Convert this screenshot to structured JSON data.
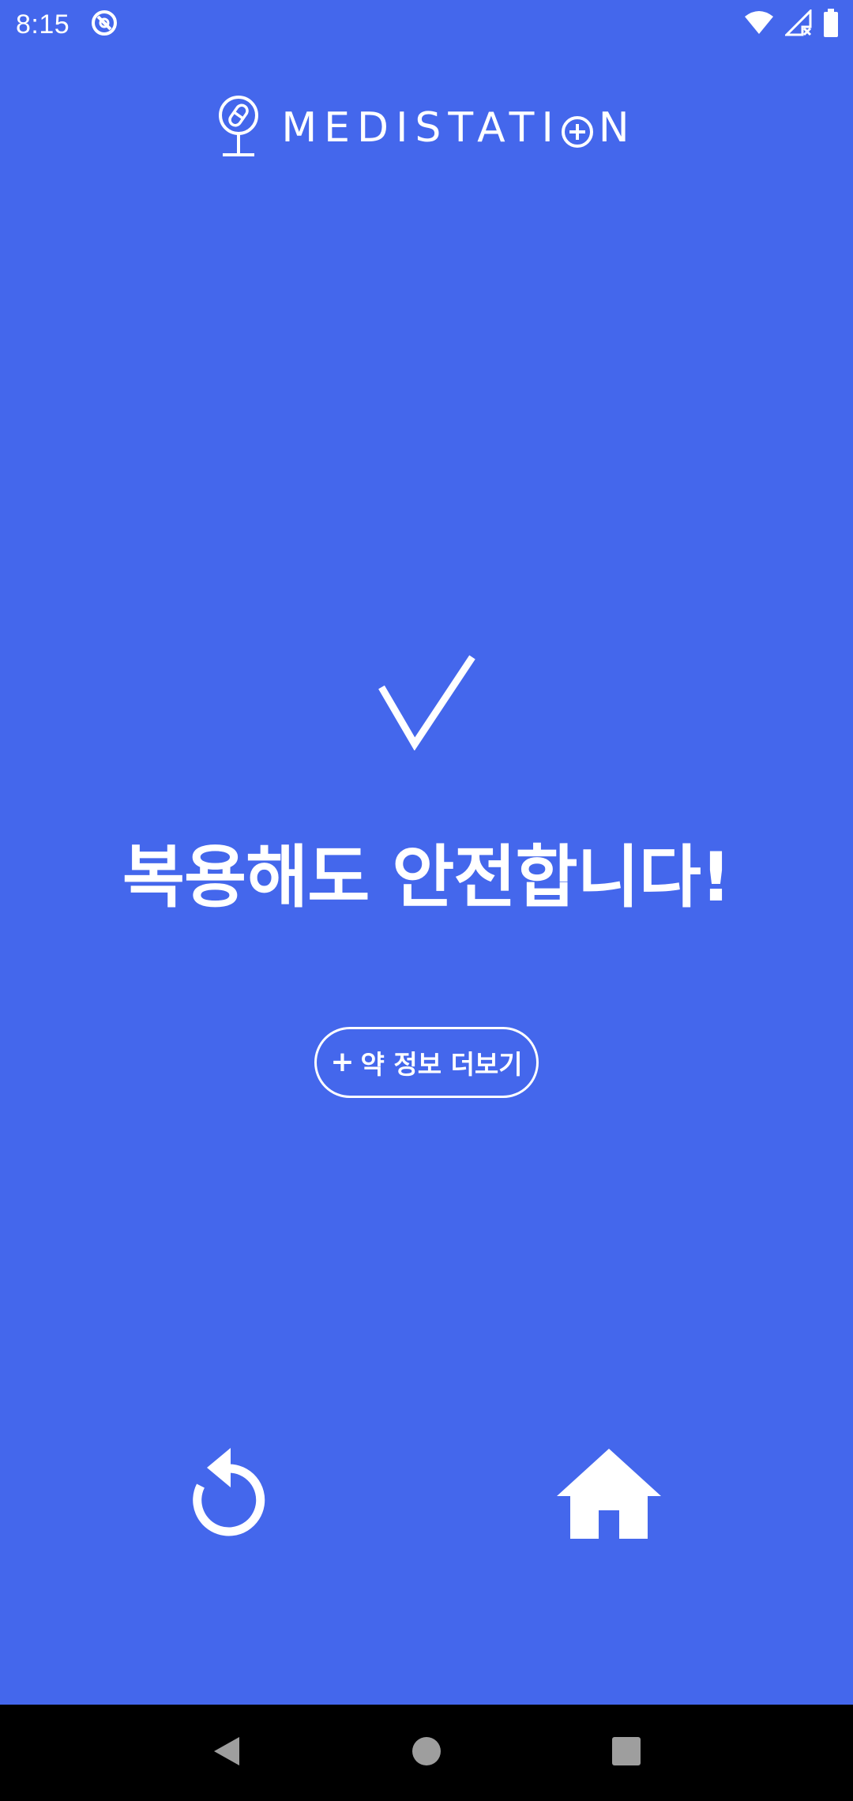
{
  "status_bar": {
    "time": "8:15",
    "icons": [
      "do-not-disturb-icon",
      "wifi-icon",
      "signal-icon",
      "battery-icon"
    ]
  },
  "header": {
    "app_name": "MEDISTATI",
    "app_name_end": "N",
    "logo_icon": "pill-magnifier-icon"
  },
  "result": {
    "status_icon": "checkmark-icon",
    "message": "복용해도 안전합니다!"
  },
  "more_info_button": {
    "icon": "plus-icon",
    "plus": "+",
    "label": "약 정보 더보기"
  },
  "actions": {
    "retry_icon": "retry-icon",
    "home_icon": "home-icon"
  },
  "navigation": {
    "back_icon": "back-triangle-icon",
    "home_icon": "home-circle-icon",
    "recents_icon": "recents-square-icon"
  },
  "colors": {
    "background": "#4467EC",
    "foreground": "#FFFFFF",
    "nav_bar": "#000000"
  }
}
